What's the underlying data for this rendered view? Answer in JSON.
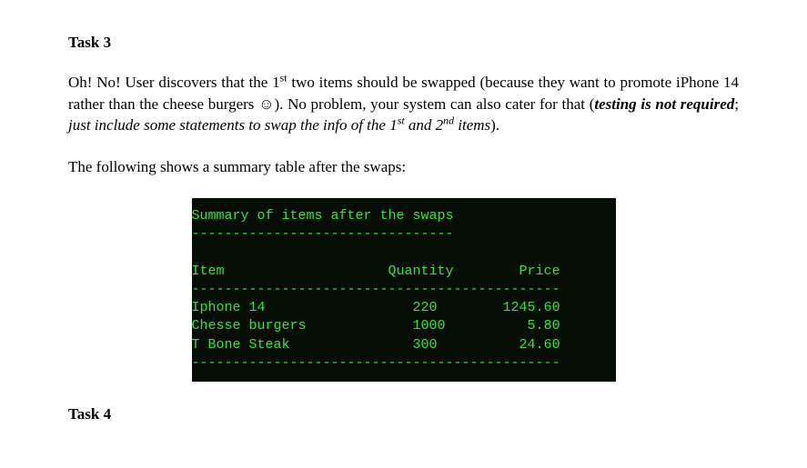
{
  "task3": {
    "heading": "Task 3",
    "para1_prefix": "Oh! No! User discovers that the 1",
    "sup_st": "st",
    "para1_mid1": " two items should be swapped (because they want to promote iPhone 14 rather than the cheese burgers ",
    "smiley": "☺",
    "para1_mid2": "). No problem, your system can also cater for that (",
    "para1_bold_italic": "testing is not required",
    "para1_mid3": "; ",
    "para1_italic_a": "just include some statements to swap the info of the 1",
    "para1_italic_b": " and 2",
    "sup_nd": "nd",
    "para1_italic_c": " items",
    "para1_end": ").",
    "para2": "The following shows a summary table after the swaps:"
  },
  "terminal": {
    "title": "Summary of items after the swaps",
    "dash_short": "--------------------------------",
    "header": "Item                    Quantity        Price",
    "dash_long": "---------------------------------------------",
    "row1": "Iphone 14                  220        1245.60",
    "row2": "Chesse burgers             1000          5.80",
    "row3": "T Bone Steak               300          24.60"
  },
  "chart_data": {
    "type": "table",
    "title": "Summary of items after the swaps",
    "columns": [
      "Item",
      "Quantity",
      "Price"
    ],
    "rows": [
      {
        "Item": "Iphone 14",
        "Quantity": 220,
        "Price": 1245.6
      },
      {
        "Item": "Chesse burgers",
        "Quantity": 1000,
        "Price": 5.8
      },
      {
        "Item": "T Bone Steak",
        "Quantity": 300,
        "Price": 24.6
      }
    ]
  },
  "task4": {
    "heading": "Task 4"
  }
}
